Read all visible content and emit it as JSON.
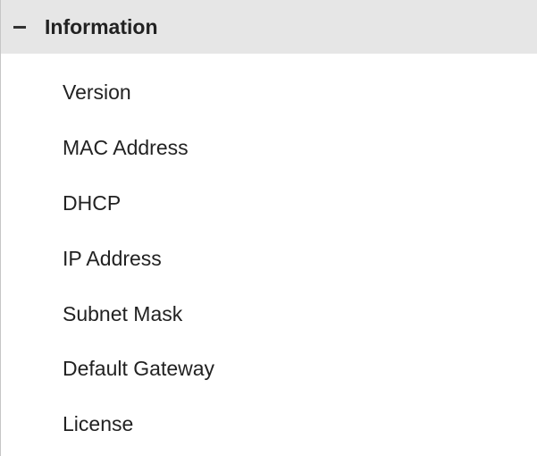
{
  "section": {
    "collapse_icon": "minus-icon",
    "title": "Information"
  },
  "menu": {
    "items": [
      {
        "label": "Version"
      },
      {
        "label": "MAC Address"
      },
      {
        "label": "DHCP"
      },
      {
        "label": "IP Address"
      },
      {
        "label": "Subnet Mask"
      },
      {
        "label": "Default Gateway"
      },
      {
        "label": "License"
      }
    ]
  },
  "colors": {
    "header_background": "#e6e6e6",
    "text": "#222222",
    "border": "#c6c6c6"
  }
}
